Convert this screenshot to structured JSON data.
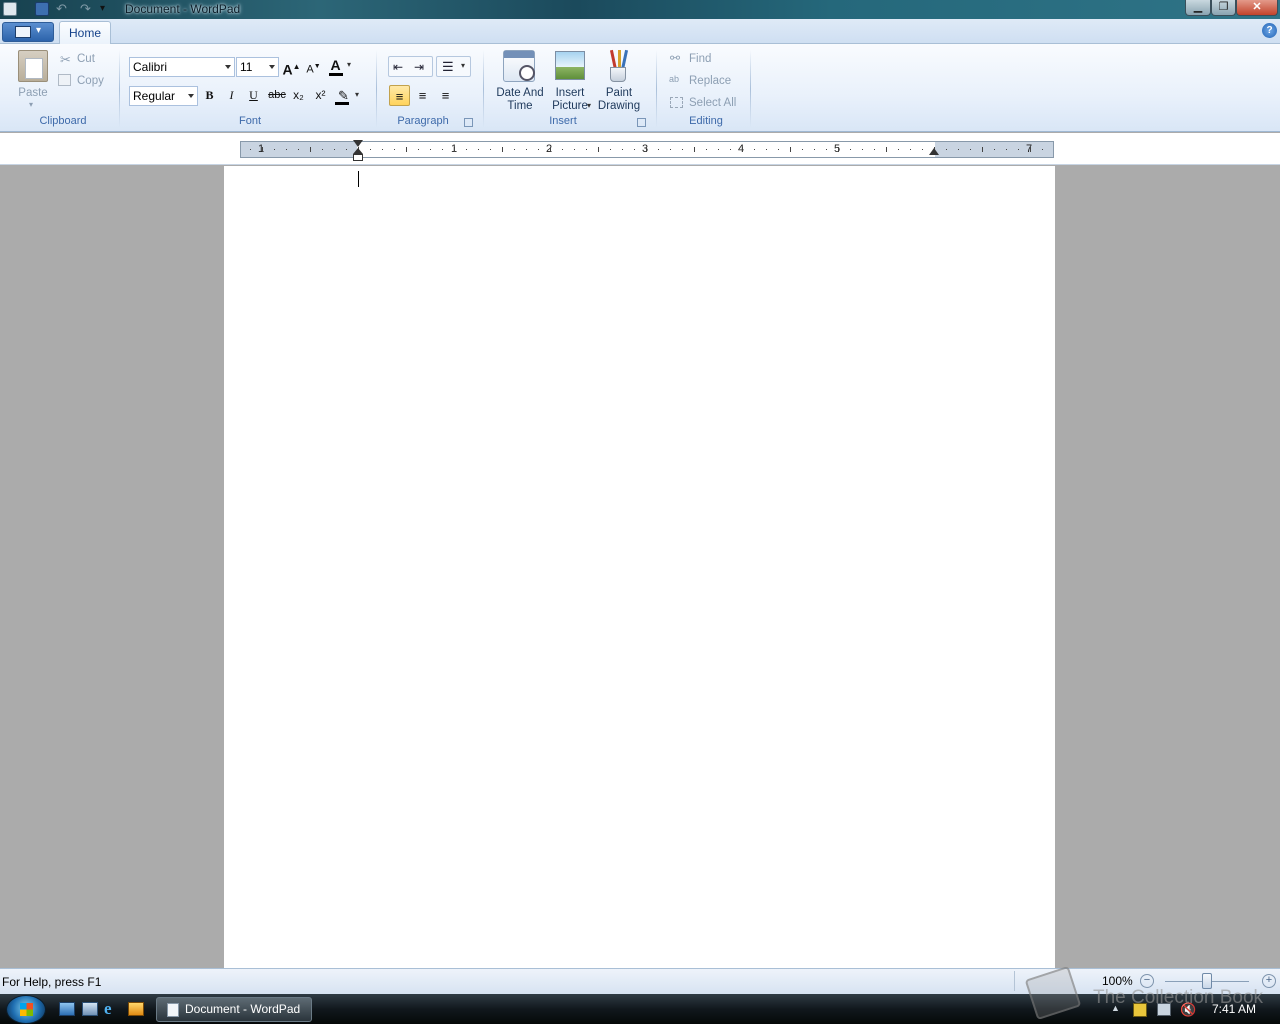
{
  "window": {
    "title": "Document - WordPad"
  },
  "tabs": {
    "home": "Home"
  },
  "clipboard": {
    "group": "Clipboard",
    "paste": "Paste",
    "cut": "Cut",
    "copy": "Copy"
  },
  "font": {
    "group": "Font",
    "family": "Calibri",
    "size": "11",
    "style": "Regular",
    "bold": "B",
    "italic": "I",
    "underline": "U",
    "strike": "abc",
    "subscript": "x₂",
    "superscript": "x²",
    "grow": "A",
    "shrink": "A",
    "color_glyph": "A"
  },
  "paragraph": {
    "group": "Paragraph",
    "alignment_selected": "left"
  },
  "insert": {
    "group": "Insert",
    "datetime_1": "Date And",
    "datetime_2": "Time",
    "picture_1": "Insert",
    "picture_2": "Picture",
    "paint_1": "Paint",
    "paint_2": "Drawing"
  },
  "editing": {
    "group": "Editing",
    "find": "Find",
    "replace": "Replace",
    "select_all": "Select All"
  },
  "ruler": {
    "labels": [
      "1",
      "1",
      "2",
      "3",
      "4",
      "5",
      "7"
    ]
  },
  "status": {
    "help": "For Help, press F1",
    "zoom": "100%"
  },
  "taskbar": {
    "task": "Document - WordPad",
    "clock": "7:41 AM",
    "watermark": "The Collection Book"
  },
  "colors": {
    "ribbon_accent": "#15428b",
    "selected_button": "#ffd35c",
    "page": "#ffffff",
    "workspace": "#ababab"
  }
}
